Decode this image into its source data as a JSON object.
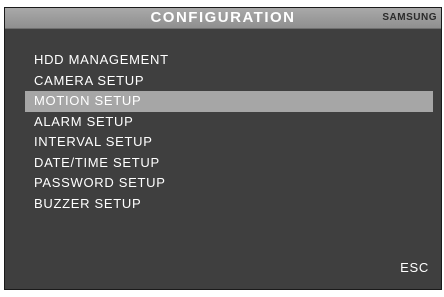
{
  "header": {
    "title": "CONFIGURATION",
    "brand": "SAMSUNG"
  },
  "menu": {
    "selected_index": 2,
    "items": [
      {
        "label": "HDD MANAGEMENT"
      },
      {
        "label": "CAMERA SETUP"
      },
      {
        "label": "MOTION SETUP"
      },
      {
        "label": "ALARM SETUP"
      },
      {
        "label": "INTERVAL SETUP"
      },
      {
        "label": "DATE/TIME SETUP"
      },
      {
        "label": "PASSWORD SETUP"
      },
      {
        "label": "BUZZER SETUP"
      }
    ]
  },
  "footer": {
    "esc_label": "ESC"
  },
  "colors": {
    "background": "#3f3f3f",
    "header": "#9c9c9c",
    "highlight": "#a6a6a6",
    "text": "#ffffff"
  }
}
